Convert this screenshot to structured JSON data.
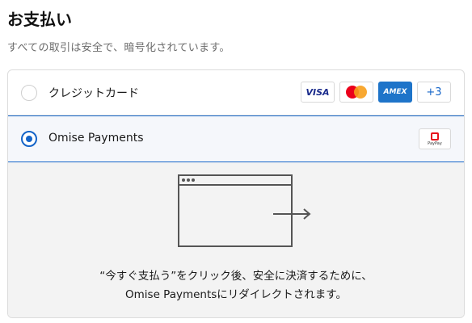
{
  "header": {
    "title": "お支払い",
    "subtitle": "すべての取引は安全で、暗号化されています。"
  },
  "payment_options": [
    {
      "label": "クレジットカード",
      "selected": false,
      "logos": [
        "VISA",
        "Mastercard",
        "AMEX",
        "+3"
      ]
    },
    {
      "label": "Omise Payments",
      "selected": true,
      "logos": [
        "PayPay"
      ]
    }
  ],
  "logo_text": {
    "visa": "VISA",
    "amex": "AMEX",
    "more": "+3",
    "paypay": "PayPay"
  },
  "redirect_panel": {
    "line1": "“今すぐ支払う”をクリック後、安全に決済するために、",
    "line2": "Omise Paymentsにリダイレクトされます。"
  },
  "colors": {
    "accent": "#1464c8",
    "panel_bg": "#f3f3f3",
    "amex": "#1e74c9",
    "paypay": "#e8151d"
  }
}
